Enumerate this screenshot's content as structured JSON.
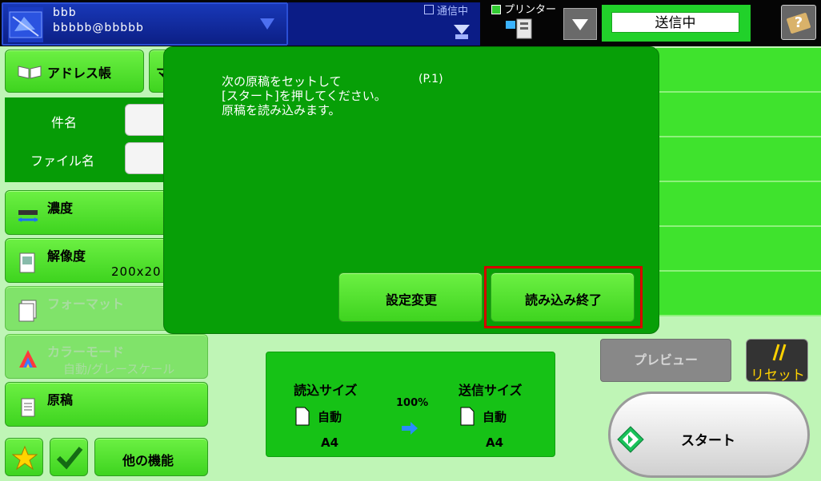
{
  "topbar": {
    "user_name": "bbb",
    "user_email": "bbbbb@bbbbb",
    "comm_label": "通信中",
    "printer_label": "プリンター",
    "status_text": "送信中",
    "help_icon": "help-book-icon"
  },
  "left": {
    "address_label": "アドレス帳",
    "tab2_label": "マ",
    "subject_label": "件名",
    "filename_label": "ファイル名",
    "density_label": "濃度",
    "resolution_label": "解像度",
    "resolution_value": "200x20",
    "format_label": "フォーマット",
    "colormode_label": "カラーモード",
    "colormode_value": "自動/グレースケール",
    "original_label": "原稿",
    "other_label": "他の機能"
  },
  "size": {
    "read_label": "読込サイズ",
    "send_label": "送信サイズ",
    "ratio": "100%",
    "read_auto": "自動",
    "send_auto": "自動",
    "read_paper": "A4",
    "send_paper": "A4"
  },
  "actions": {
    "preview_label": "プレビュー",
    "reset_label": "リセット",
    "start_label": "スタート"
  },
  "dialog": {
    "line1": "次の原稿をセットして",
    "page_indicator": "(P.1)",
    "line2": "[スタート]を押してください。",
    "line3": "原稿を読み込みます。",
    "settings_change_label": "設定変更",
    "scan_end_label": "読み込み終了"
  },
  "colors": {
    "accent_green": "#3ed41f",
    "dialog_green": "#079f07",
    "topbar_blue": "#0c1f86",
    "highlight_red": "#d60000"
  }
}
